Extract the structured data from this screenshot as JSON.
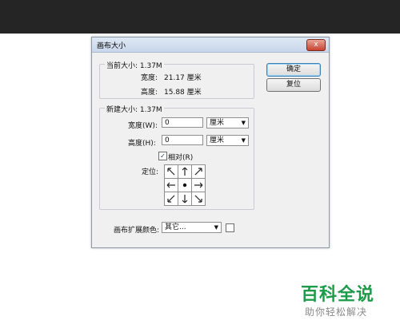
{
  "dialog": {
    "title": "画布大小",
    "close": "x",
    "current": {
      "legend": "当前大小: 1.37M",
      "width_label": "宽度:",
      "width_value": "21.17 厘米",
      "height_label": "高度:",
      "height_value": "15.88 厘米"
    },
    "new": {
      "legend": "新建大小: 1.37M",
      "width_label": "宽度(W):",
      "width_value": "0",
      "width_unit": "厘米",
      "height_label": "高度(H):",
      "height_value": "0",
      "height_unit": "厘米",
      "relative_label": "相对(R)",
      "relative_checked": true,
      "anchor_label": "定位:"
    },
    "ext_color_label": "画布扩展颜色:",
    "ext_color_value": "其它...",
    "buttons": {
      "ok": "确定",
      "reset": "复位"
    }
  },
  "watermark": {
    "brand": "百科全说",
    "slogan": "助你轻松解决"
  },
  "colors": {
    "brand_green": "#1d9a4a",
    "topbar": "#252525"
  }
}
